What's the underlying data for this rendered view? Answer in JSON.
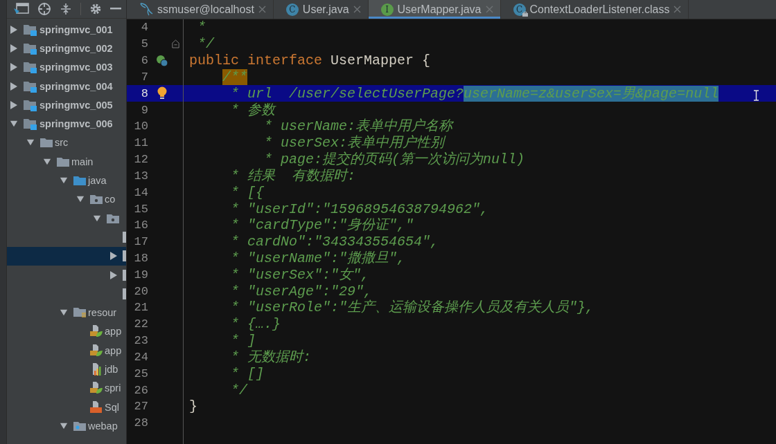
{
  "tabs": [
    {
      "label": "ssmuser@localhost",
      "kind": "database",
      "selected": false
    },
    {
      "label": "User.java",
      "kind": "class",
      "icon_letter": "C",
      "selected": false
    },
    {
      "label": "UserMapper.java",
      "kind": "interface",
      "icon_letter": "I",
      "selected": true
    },
    {
      "label": "ContextLoaderListener.class",
      "kind": "locked-class",
      "icon_letter": "C",
      "selected": false
    }
  ],
  "project_tree": [
    {
      "label": "springmvc_001",
      "kind": "module",
      "expanded": false,
      "selected": false
    },
    {
      "label": "springmvc_002",
      "kind": "module",
      "expanded": false,
      "selected": false
    },
    {
      "label": "springmvc_003",
      "kind": "module",
      "expanded": false,
      "selected": false
    },
    {
      "label": "springmvc_004",
      "kind": "module",
      "expanded": false,
      "selected": false
    },
    {
      "label": "springmvc_005",
      "kind": "module",
      "expanded": false,
      "selected": false
    },
    {
      "label": "springmvc_006",
      "kind": "module",
      "expanded": true,
      "selected": false,
      "children": [
        {
          "label": "src",
          "kind": "folder",
          "expanded": true,
          "selected": false,
          "children": [
            {
              "label": "main",
              "kind": "folder",
              "expanded": true,
              "selected": false,
              "children": [
                {
                  "label": "java",
                  "kind": "source",
                  "expanded": true,
                  "selected": false,
                  "children": [
                    {
                      "label": "co",
                      "kind": "package",
                      "expanded": true,
                      "selected": false,
                      "children": [
                        {
                          "kind": "package",
                          "expanded": true,
                          "selected": false,
                          "children": [
                            {
                              "kind": "file",
                              "selected": false
                            },
                            {
                              "kind": "file",
                              "expanded": false,
                              "selected": true
                            },
                            {
                              "kind": "file",
                              "expanded": false,
                              "selected": false
                            },
                            {
                              "kind": "file",
                              "selected": false
                            }
                          ]
                        }
                      ]
                    }
                  ]
                },
                {
                  "label": "resour",
                  "kind": "resources",
                  "expanded": true,
                  "selected": false,
                  "children": [
                    {
                      "label": "app",
                      "kind": "spring-xml",
                      "selected": false
                    },
                    {
                      "label": "app",
                      "kind": "spring-xml",
                      "selected": false
                    },
                    {
                      "label": "jdb",
                      "kind": "properties",
                      "selected": false
                    },
                    {
                      "label": "spri",
                      "kind": "spring-xml",
                      "selected": false
                    },
                    {
                      "label": "Sql",
                      "kind": "xml",
                      "selected": false
                    }
                  ]
                },
                {
                  "label": "webap",
                  "kind": "web",
                  "expanded": true,
                  "selected": false
                }
              ]
            }
          ]
        }
      ]
    }
  ],
  "editor_lines": [
    {
      "number": "4",
      "current": false,
      "segments": [
        {
          "text": " *",
          "kind": "comment"
        }
      ]
    },
    {
      "number": "5",
      "current": false,
      "gutter_icon": {
        "kind": "fold"
      },
      "segments": [
        {
          "text": " */",
          "kind": "comment"
        }
      ]
    },
    {
      "number": "6",
      "current": false,
      "gutter_icon": {
        "kind": "implemented"
      },
      "segments": [
        {
          "text": "public",
          "kind": "keyword"
        },
        {
          "text": " interface",
          "kind": "keyword"
        },
        {
          "text": " UserMapper {",
          "kind": "plain"
        }
      ]
    },
    {
      "number": "7",
      "current": false,
      "segments": [
        {
          "text": "/**",
          "kind": "brace-match"
        }
      ]
    },
    {
      "number": "8",
      "current": true,
      "gutter_icon": {
        "kind": "intention"
      },
      "segments": [
        {
          "text": "     * url  /user/selectUserPage?",
          "kind": "comment"
        },
        {
          "text": "userName=z&userSex=男&page=null",
          "kind": "selection"
        }
      ]
    },
    {
      "number": "9",
      "current": false,
      "segments": [
        {
          "text": "     * 参数",
          "kind": "comment"
        }
      ]
    },
    {
      "number": "10",
      "current": false,
      "segments": [
        {
          "text": "         * userName:表单中用户名称",
          "kind": "comment"
        }
      ]
    },
    {
      "number": "11",
      "current": false,
      "segments": [
        {
          "text": "         * userSex:表单中用户性别",
          "kind": "comment"
        }
      ]
    },
    {
      "number": "12",
      "current": false,
      "segments": [
        {
          "text": "         * page:提交的页码(第一次访问为null)",
          "kind": "comment"
        }
      ]
    },
    {
      "number": "13",
      "current": false,
      "segments": [
        {
          "text": "     * 结果  有数据时:",
          "kind": "comment"
        }
      ]
    },
    {
      "number": "14",
      "current": false,
      "segments": [
        {
          "text": "     * [{",
          "kind": "comment"
        }
      ]
    },
    {
      "number": "15",
      "current": false,
      "segments": [
        {
          "text": "     * \"userId\":\"15968954638794962\",",
          "kind": "comment"
        }
      ]
    },
    {
      "number": "16",
      "current": false,
      "segments": [
        {
          "text": "     * \"cardType\":\"身份证\",\"",
          "kind": "comment"
        }
      ]
    },
    {
      "number": "17",
      "current": false,
      "segments": [
        {
          "text": "     * cardNo\":\"343343554654\",",
          "kind": "comment"
        }
      ]
    },
    {
      "number": "18",
      "current": false,
      "segments": [
        {
          "text": "     * \"userName\":\"撒撒旦\",",
          "kind": "comment"
        }
      ]
    },
    {
      "number": "19",
      "current": false,
      "segments": [
        {
          "text": "     * \"userSex\":\"女\",",
          "kind": "comment"
        }
      ]
    },
    {
      "number": "20",
      "current": false,
      "segments": [
        {
          "text": "     * \"userAge\":\"29\",",
          "kind": "comment"
        }
      ]
    },
    {
      "number": "21",
      "current": false,
      "segments": [
        {
          "text": "     * \"userRole\":\"生产、运输设备操作人员及有关人员\"},",
          "kind": "comment"
        }
      ]
    },
    {
      "number": "22",
      "current": false,
      "segments": [
        {
          "text": "     * {….}",
          "kind": "comment"
        }
      ]
    },
    {
      "number": "23",
      "current": false,
      "segments": [
        {
          "text": "     * ]",
          "kind": "comment"
        }
      ]
    },
    {
      "number": "24",
      "current": false,
      "segments": [
        {
          "text": "     * 无数据时:",
          "kind": "comment"
        }
      ]
    },
    {
      "number": "25",
      "current": false,
      "segments": [
        {
          "text": "     * []",
          "kind": "comment"
        }
      ]
    },
    {
      "number": "26",
      "current": false,
      "segments": [
        {
          "text": "     */",
          "kind": "comment"
        }
      ]
    },
    {
      "number": "27",
      "current": false,
      "segments": [
        {
          "text": "}",
          "kind": "plain"
        }
      ]
    },
    {
      "number": "28",
      "current": false
    }
  ]
}
